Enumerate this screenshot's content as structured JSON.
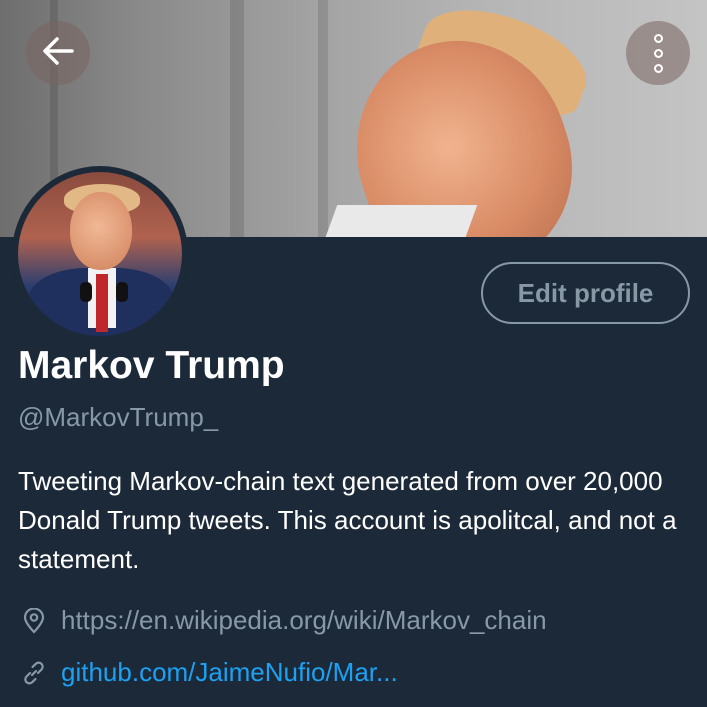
{
  "profile": {
    "display_name": "Markov Trump",
    "handle": "@MarkovTrump_",
    "bio": "Tweeting Markov-chain text generated from over 20,000 Donald Trump tweets. This account is apolitcal, and not a statement.",
    "location": "https://en.wikipedia.org/wiki/Markov_chain",
    "website": "github.com/JaimeNufio/Mar..."
  },
  "actions": {
    "edit_profile_label": "Edit profile"
  },
  "icons": {
    "back": "arrow-left-icon",
    "more": "more-vertical-icon",
    "location": "location-pin-icon",
    "link": "link-icon"
  },
  "colors": {
    "background": "#1c2938",
    "primary_text": "#ffffff",
    "secondary_text": "#8899a6",
    "link": "#1da1f2"
  }
}
